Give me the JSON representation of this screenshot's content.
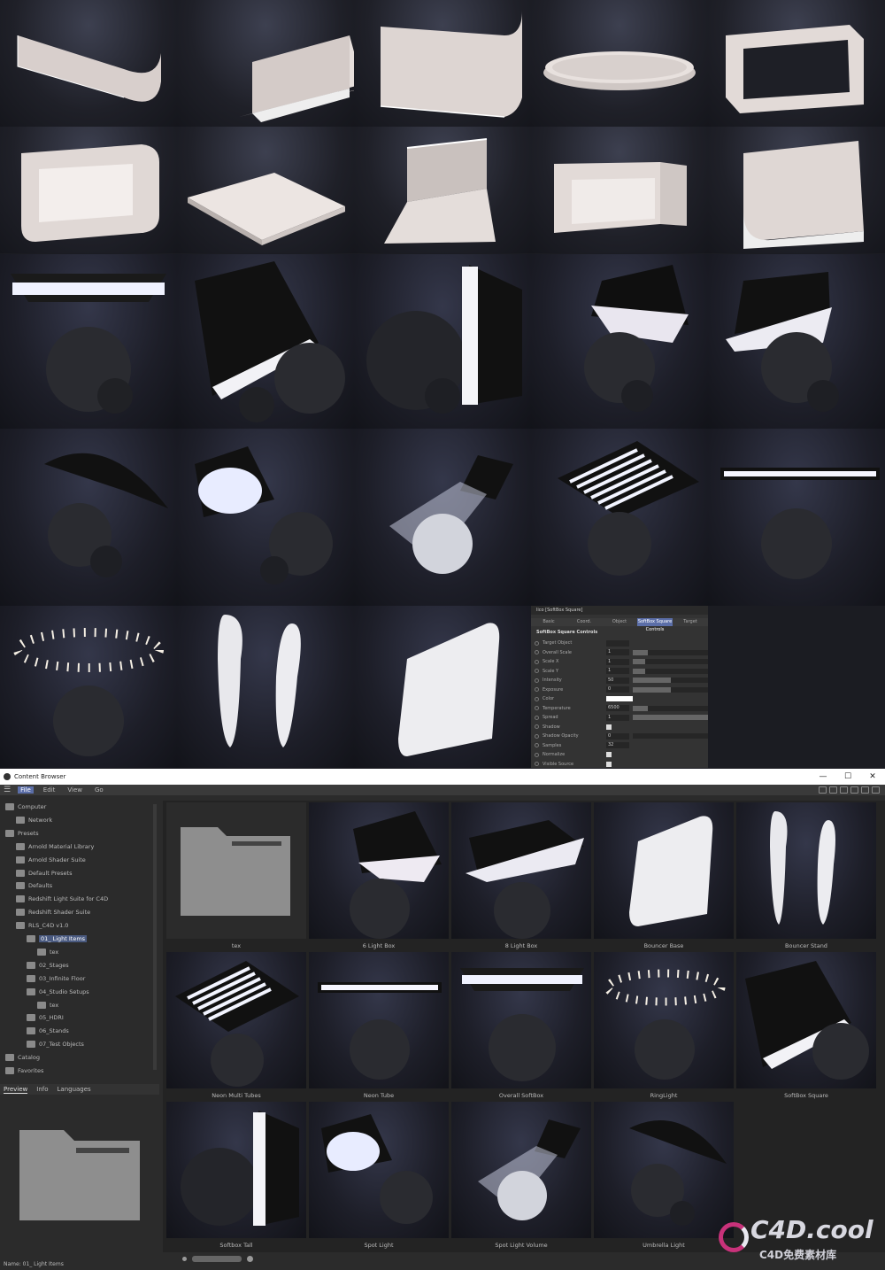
{
  "attribute_panel": {
    "title": "lico [SoftBox Square]",
    "tabs": [
      "Basic",
      "Coord.",
      "Object",
      "SoftBox Square Controls",
      "Target"
    ],
    "active_tab": "SoftBox Square Controls",
    "section": "SoftBox Square Controls",
    "rows": [
      {
        "label": "Target Object",
        "value": ""
      },
      {
        "label": "Overall Scale",
        "value": "1",
        "level": 0.2
      },
      {
        "label": "Scale X",
        "value": "1",
        "level": 0.17
      },
      {
        "label": "Scale Y",
        "value": "1",
        "level": 0.17
      },
      {
        "label": "Intensity",
        "value": "50",
        "level": 0.5
      },
      {
        "label": "Exposure",
        "value": "0",
        "level": 0.5
      },
      {
        "label": "Color",
        "value": ""
      },
      {
        "label": "Temperature",
        "value": "6500",
        "level": 0.2
      },
      {
        "label": "Spread",
        "value": "1",
        "level": 1.0
      },
      {
        "label": "Shadow",
        "value": ""
      },
      {
        "label": "Shadow Opacity",
        "value": "0",
        "level": 0.0
      },
      {
        "label": "Samples",
        "value": "32"
      },
      {
        "label": "Normalize",
        "value": ""
      },
      {
        "label": "Visible Source",
        "value": ""
      }
    ]
  },
  "window": {
    "title": "Content Browser",
    "controls": [
      "—",
      "☐",
      "✕"
    ],
    "menu": [
      "File",
      "Edit",
      "View",
      "Go"
    ],
    "active_menu": "File"
  },
  "tree": [
    {
      "label": "Computer",
      "indent": 0
    },
    {
      "label": "Network",
      "indent": 1
    },
    {
      "label": "Presets",
      "indent": 0
    },
    {
      "label": "Arnold Material Library",
      "indent": 1
    },
    {
      "label": "Arnold Shader Suite",
      "indent": 1
    },
    {
      "label": "Default Presets",
      "indent": 1
    },
    {
      "label": "Defaults",
      "indent": 1
    },
    {
      "label": "Redshift Light Suite for C4D",
      "indent": 1
    },
    {
      "label": "Redshift Shader Suite",
      "indent": 1
    },
    {
      "label": "RLS_C4D v1.0",
      "indent": 1
    },
    {
      "label": "01_ Light Items",
      "indent": 2,
      "selected": true
    },
    {
      "label": "tex",
      "indent": 3
    },
    {
      "label": "02_Stages",
      "indent": 2
    },
    {
      "label": "03_Infinite Floor",
      "indent": 2
    },
    {
      "label": "04_Studio Setups",
      "indent": 2
    },
    {
      "label": "tex",
      "indent": 3
    },
    {
      "label": "05_HDRI",
      "indent": 2
    },
    {
      "label": "06_Stands",
      "indent": 2
    },
    {
      "label": "07_Test Objects",
      "indent": 2
    },
    {
      "label": "Catalog",
      "indent": 0
    },
    {
      "label": "Favorites",
      "indent": 0
    }
  ],
  "preview_tabs": [
    "Preview",
    "Info",
    "Languages"
  ],
  "preview_name": "Name: 01_ Light Items",
  "items": [
    {
      "name": "tex",
      "kind": "folder"
    },
    {
      "name": "6 Light Box",
      "kind": "hex"
    },
    {
      "name": "8 Light Box",
      "kind": "oct"
    },
    {
      "name": "Bouncer Base",
      "kind": "bouncer"
    },
    {
      "name": "Bouncer Stand",
      "kind": "stand"
    },
    {
      "name": "Neon Multi Tubes",
      "kind": "tubes"
    },
    {
      "name": "Neon Tube",
      "kind": "tube"
    },
    {
      "name": "Overall SoftBox",
      "kind": "overhead"
    },
    {
      "name": "RingLight",
      "kind": "ring"
    },
    {
      "name": "SoftBox Square",
      "kind": "square"
    },
    {
      "name": "Softbox Tall",
      "kind": "tall"
    },
    {
      "name": "Spot Light",
      "kind": "spot"
    },
    {
      "name": "Spot Light Volume",
      "kind": "volume"
    },
    {
      "name": "Umbrella Light",
      "kind": "umbrella"
    }
  ],
  "watermark": {
    "brand": "C4D.cool",
    "sub": "C4D免费素材库",
    "accent": "#c8327a"
  }
}
